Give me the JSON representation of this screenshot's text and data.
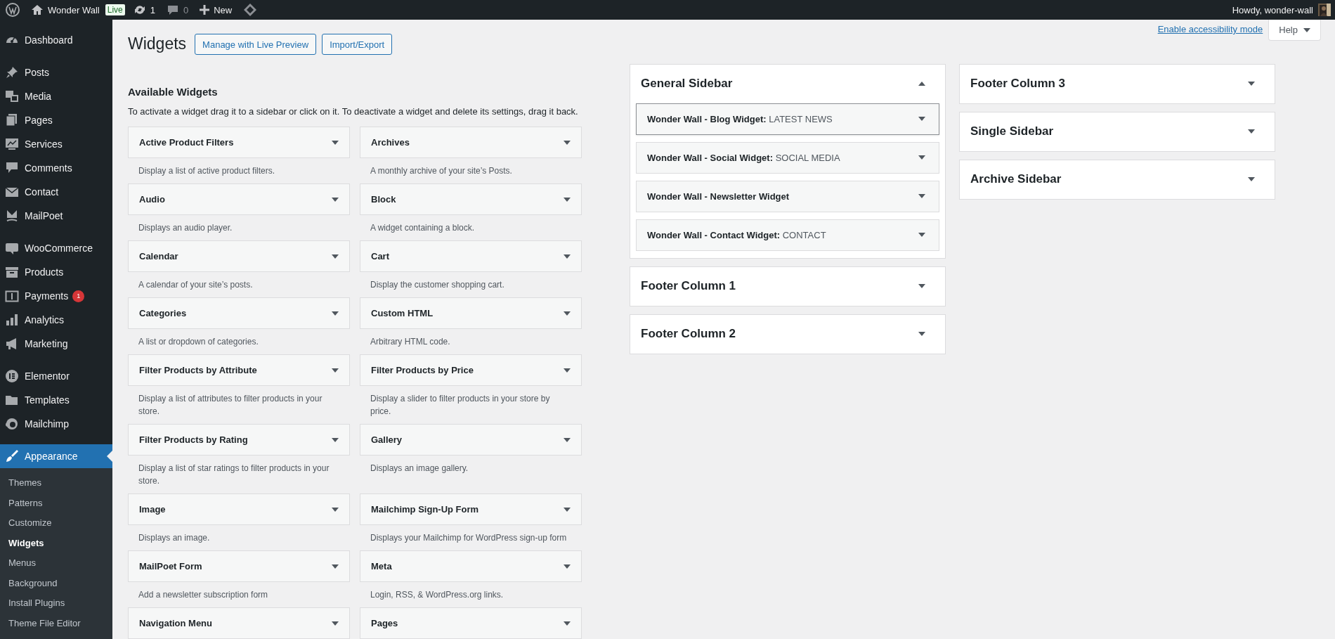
{
  "admin_bar": {
    "site_name": "Wonder Wall",
    "live_badge": "Live",
    "updates": "1",
    "comments": "0",
    "new_label": "New",
    "greeting": "Howdy, wonder-wall"
  },
  "admin_menu": [
    [
      {
        "label": "Dashboard",
        "selected": false
      }
    ],
    [
      {
        "label": "Posts",
        "selected": false
      },
      {
        "label": "Media",
        "selected": false
      },
      {
        "label": "Pages",
        "selected": false
      },
      {
        "label": "Services",
        "selected": false
      },
      {
        "label": "Comments",
        "selected": false
      },
      {
        "label": "Contact",
        "selected": false
      },
      {
        "label": "MailPoet",
        "selected": false
      }
    ],
    [
      {
        "label": "WooCommerce",
        "selected": false
      },
      {
        "label": "Products",
        "selected": false
      },
      {
        "label": "Payments",
        "selected": false,
        "badge": "1"
      },
      {
        "label": "Analytics",
        "selected": false
      },
      {
        "label": "Marketing",
        "selected": false
      }
    ],
    [
      {
        "label": "Elementor",
        "selected": false
      },
      {
        "label": "Templates",
        "selected": false
      },
      {
        "label": "Mailchimp",
        "selected": false
      }
    ],
    [
      {
        "label": "Appearance",
        "selected": true,
        "submenu": [
          {
            "label": "Themes",
            "selected": false
          },
          {
            "label": "Patterns",
            "selected": false
          },
          {
            "label": "Customize",
            "selected": false
          },
          {
            "label": "Widgets",
            "selected": true
          },
          {
            "label": "Menus",
            "selected": false
          },
          {
            "label": "Background",
            "selected": false
          },
          {
            "label": "Install Plugins",
            "selected": false
          },
          {
            "label": "Theme File Editor",
            "selected": false
          }
        ]
      }
    ]
  ],
  "page": {
    "title": "Widgets",
    "buttons": [
      "Manage with Live Preview",
      "Import/Export"
    ],
    "accessibility_link": "Enable accessibility mode",
    "help_tab": "Help"
  },
  "available_widgets": {
    "heading": "Available Widgets",
    "description": "To activate a widget drag it to a sidebar or click on it. To deactivate a widget and delete its settings, drag it back.",
    "widgets": [
      {
        "title": "Active Product Filters",
        "description": "Display a list of active product filters."
      },
      {
        "title": "Archives",
        "description": "A monthly archive of your site’s Posts."
      },
      {
        "title": "Audio",
        "description": "Displays an audio player."
      },
      {
        "title": "Block",
        "description": "A widget containing a block."
      },
      {
        "title": "Calendar",
        "description": "A calendar of your site’s posts."
      },
      {
        "title": "Cart",
        "description": "Display the customer shopping cart."
      },
      {
        "title": "Categories",
        "description": "A list or dropdown of categories."
      },
      {
        "title": "Custom HTML",
        "description": "Arbitrary HTML code."
      },
      {
        "title": "Filter Products by Attribute",
        "description": "Display a list of attributes to filter products in your store."
      },
      {
        "title": "Filter Products by Price",
        "description": "Display a slider to filter products in your store by price."
      },
      {
        "title": "Filter Products by Rating",
        "description": "Display a list of star ratings to filter products in your store."
      },
      {
        "title": "Gallery",
        "description": "Displays an image gallery."
      },
      {
        "title": "Image",
        "description": "Displays an image."
      },
      {
        "title": "Mailchimp Sign-Up Form",
        "description": "Displays your Mailchimp for WordPress sign-up form"
      },
      {
        "title": "MailPoet Form",
        "description": "Add a newsletter subscription form"
      },
      {
        "title": "Meta",
        "description": "Login, RSS, & WordPress.org links."
      },
      {
        "title": "Navigation Menu"
      },
      {
        "title": "Pages"
      }
    ]
  },
  "sidebar_columns": [
    [
      {
        "title": "General Sidebar",
        "expanded": true,
        "widgets": [
          {
            "title": "Wonder Wall - Blog Widget:",
            "subtitle": "LATEST NEWS",
            "focused": true
          },
          {
            "title": "Wonder Wall - Social Widget:",
            "subtitle": "SOCIAL MEDIA",
            "focused": false
          },
          {
            "title": "Wonder Wall - Newsletter Widget",
            "focused": false
          },
          {
            "title": "Wonder Wall - Contact Widget:",
            "subtitle": "CONTACT",
            "focused": false
          }
        ]
      },
      {
        "title": "Footer Column 1",
        "expanded": false
      },
      {
        "title": "Footer Column 2",
        "expanded": false
      }
    ],
    [
      {
        "title": "Footer Column 3",
        "expanded": false
      },
      {
        "title": "Single Sidebar",
        "expanded": false
      },
      {
        "title": "Archive Sidebar",
        "expanded": false
      }
    ]
  ]
}
